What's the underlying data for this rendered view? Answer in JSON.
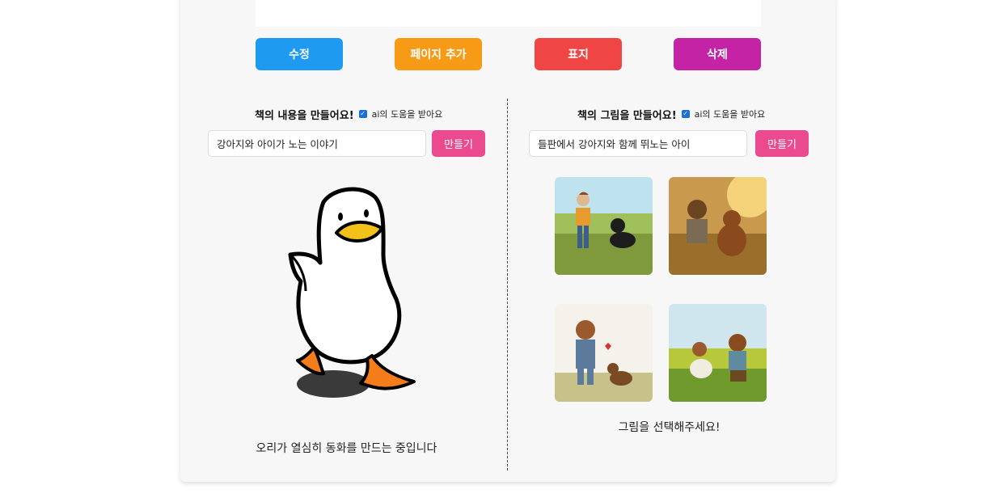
{
  "toolbar": {
    "edit_label": "수정",
    "add_page_label": "페이지 추가",
    "cover_label": "표지",
    "delete_label": "삭제",
    "colors": {
      "edit": "#1e9bf0",
      "add_page": "#f79b16",
      "cover": "#f04545",
      "delete": "#c323a4"
    }
  },
  "text_section": {
    "title": "책의 내용을 만들어요!",
    "ai_help_label": "ai의 도움을 받아요",
    "ai_help_checked": true,
    "input_value": "강아지와 아이가 노는 이야기",
    "make_label": "만들기",
    "loading_icon": "duck-illustration",
    "status": "오리가 열심히 동화를 만드는 중입니다"
  },
  "image_section": {
    "title": "책의 그림을 만들어요!",
    "ai_help_label": "ai의 도움을 받아요",
    "ai_help_checked": true,
    "input_value": "들판에서 강아지와 함께 뛰노는 아이",
    "make_label": "만들기",
    "thumbnails": [
      "boy-with-black-dog",
      "child-with-brown-dog",
      "girl-with-puppy-heart",
      "boy-with-beagle"
    ],
    "prompt": "그림을 선택해주세요!"
  },
  "accent": "#ec4a8e"
}
